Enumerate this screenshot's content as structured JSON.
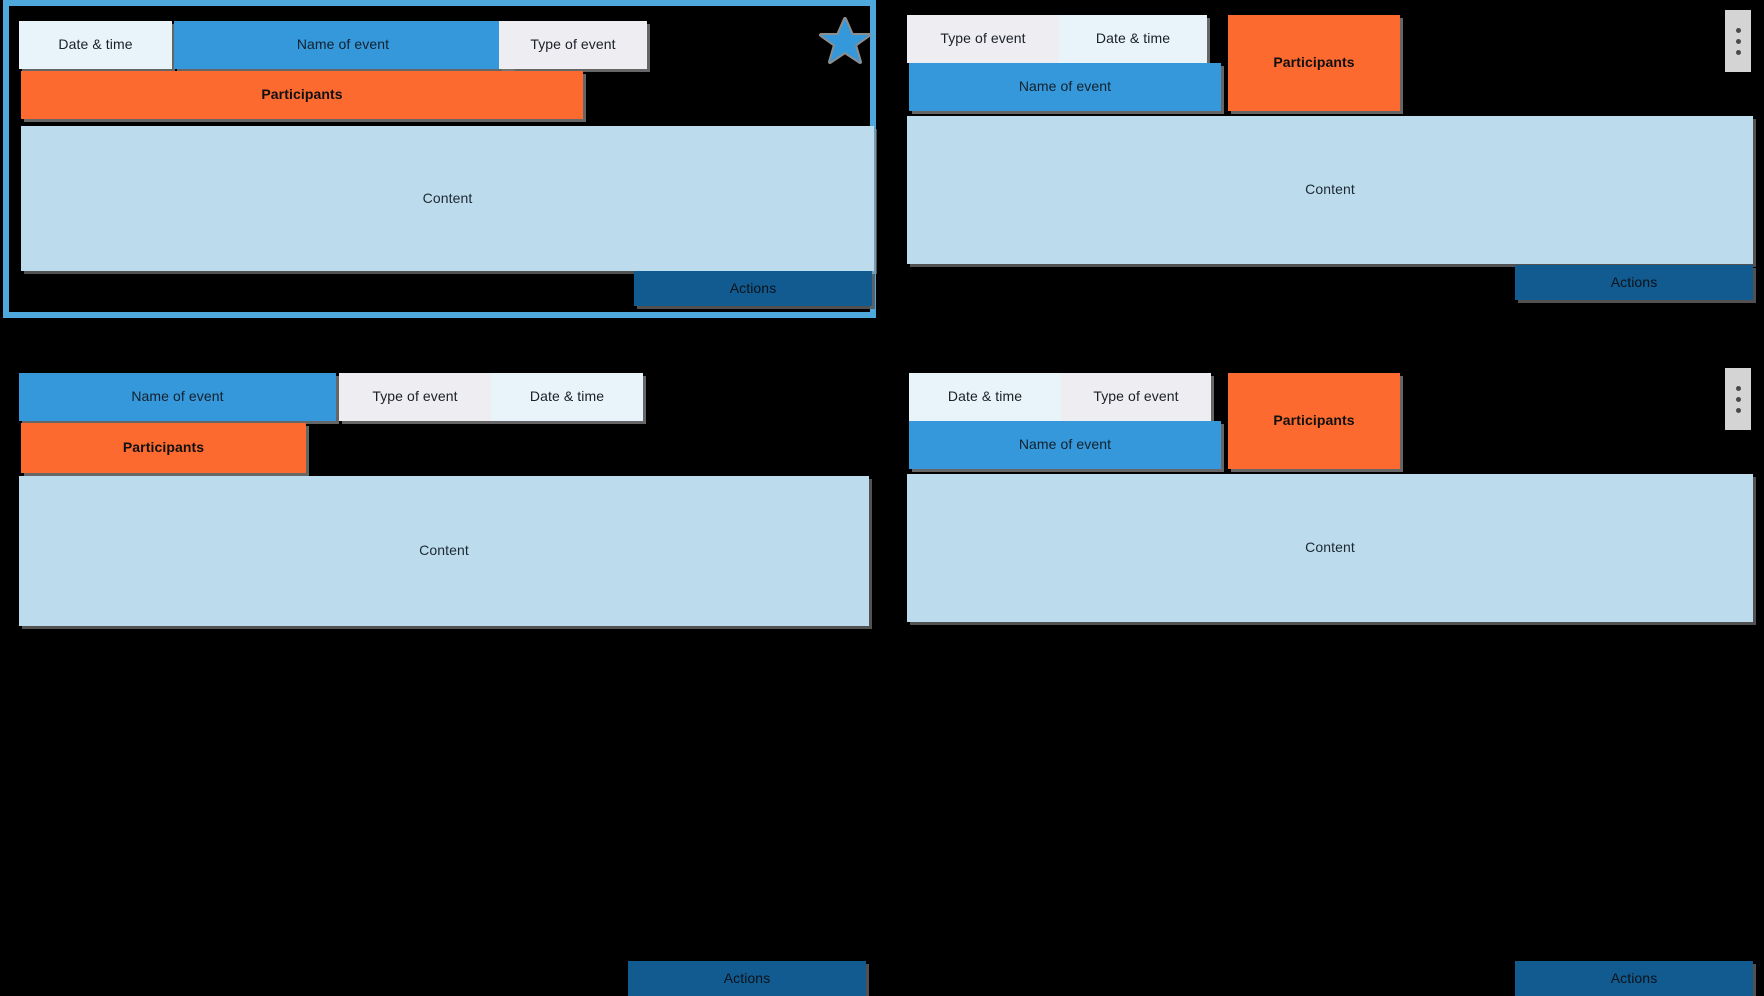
{
  "canvas": {
    "background": "#000000",
    "selection_color": "#4FA8DC"
  },
  "palette": {
    "pale_blue": "#E8F4FA",
    "pale_gray": "#EDEDF2",
    "blue": "#3498DB",
    "orange": "#FC6A30",
    "content_blue": "#BCDCEE",
    "actions_blue": "#115B91",
    "kebab_gray": "#D4D4D4"
  },
  "labels": {
    "date_time": "Date & time",
    "name_of_event": "Name of event",
    "type_of_event": "Type of event",
    "participants": "Participants",
    "content": "Content",
    "actions": "Actions"
  },
  "icons": {
    "star": "star-icon",
    "kebab": "more-vertical-icon"
  },
  "cards": [
    {
      "id": "card-top-left",
      "selected": true,
      "has_star": true,
      "has_kebab": false,
      "blocks": [
        {
          "name": "date-time-chip",
          "label": "Date & time",
          "style": "pale-blue"
        },
        {
          "name": "name-of-event-chip",
          "label": "Name of event",
          "style": "blue"
        },
        {
          "name": "type-of-event-chip",
          "label": "Type of event",
          "style": "pale-gray"
        },
        {
          "name": "participants-chip",
          "label": "Participants",
          "style": "orange"
        },
        {
          "name": "content-area",
          "label": "Content",
          "style": "content"
        },
        {
          "name": "actions-button",
          "label": "Actions",
          "style": "actions"
        }
      ]
    },
    {
      "id": "card-top-right",
      "selected": false,
      "has_star": false,
      "has_kebab": true,
      "blocks": [
        {
          "name": "type-of-event-chip",
          "label": "Type of event",
          "style": "pale-gray"
        },
        {
          "name": "date-time-chip",
          "label": "Date & time",
          "style": "pale-blue"
        },
        {
          "name": "name-of-event-chip",
          "label": "Name of event",
          "style": "blue"
        },
        {
          "name": "participants-chip",
          "label": "Participants",
          "style": "orange"
        },
        {
          "name": "content-area",
          "label": "Content",
          "style": "content"
        },
        {
          "name": "actions-button",
          "label": "Actions",
          "style": "actions"
        }
      ]
    },
    {
      "id": "card-bottom-left",
      "selected": false,
      "has_star": false,
      "has_kebab": false,
      "blocks": [
        {
          "name": "name-of-event-chip",
          "label": "Name of event",
          "style": "blue"
        },
        {
          "name": "type-of-event-chip",
          "label": "Type of event",
          "style": "pale-gray"
        },
        {
          "name": "date-time-chip",
          "label": "Date & time",
          "style": "pale-blue"
        },
        {
          "name": "participants-chip",
          "label": "Participants",
          "style": "orange"
        },
        {
          "name": "content-area",
          "label": "Content",
          "style": "content"
        },
        {
          "name": "actions-button",
          "label": "Actions",
          "style": "actions"
        }
      ]
    },
    {
      "id": "card-bottom-right",
      "selected": false,
      "has_star": false,
      "has_kebab": true,
      "blocks": [
        {
          "name": "date-time-chip",
          "label": "Date & time",
          "style": "pale-blue"
        },
        {
          "name": "type-of-event-chip",
          "label": "Type of event",
          "style": "pale-gray"
        },
        {
          "name": "name-of-event-chip",
          "label": "Name of event",
          "style": "blue"
        },
        {
          "name": "participants-chip",
          "label": "Participants",
          "style": "orange"
        },
        {
          "name": "content-area",
          "label": "Content",
          "style": "content"
        },
        {
          "name": "actions-button",
          "label": "Actions",
          "style": "actions"
        }
      ]
    }
  ]
}
